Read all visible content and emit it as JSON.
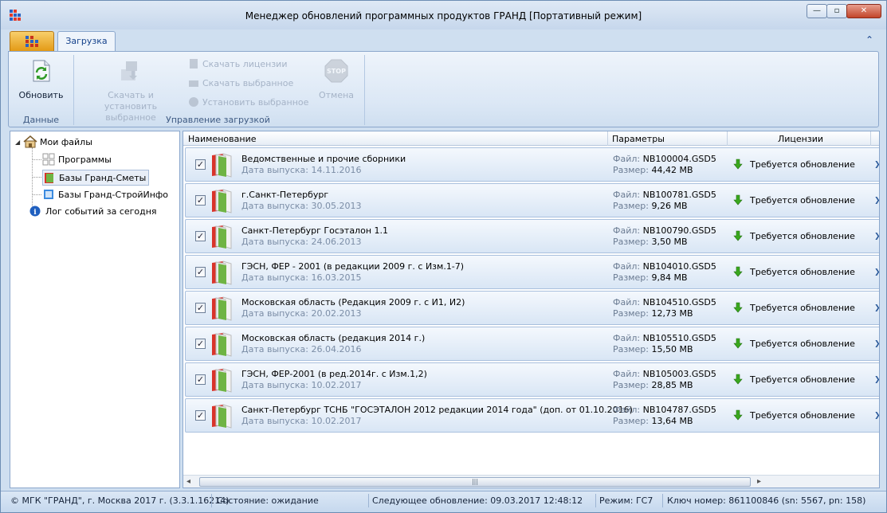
{
  "window": {
    "title": "Менеджер обновлений программных продуктов ГРАНД [Портативный режим]",
    "controls": {
      "minimize": "—",
      "maximize": "▫",
      "close": "✕"
    }
  },
  "tabs": {
    "active": "Загрузка"
  },
  "ribbon": {
    "refresh": "Обновить",
    "group_data": "Данные",
    "download_install": "Скачать и установить выбранное",
    "download_licenses": "Скачать лицензии",
    "download_selected": "Скачать выбранное",
    "install_selected": "Установить выбранное",
    "cancel": "Отмена",
    "group_download": "Управление загрузкой"
  },
  "tree": {
    "root": "Мои файлы",
    "programs": "Программы",
    "bases_smety": "Базы Гранд-Сметы",
    "bases_stroy": "Базы Гранд-СтройИнфо",
    "log": "Лог событий за сегодня"
  },
  "list": {
    "headers": {
      "name": "Наименование",
      "params": "Параметры",
      "licenses": "Лицензии"
    },
    "labels": {
      "release": "Дата выпуска:",
      "file": "Файл:",
      "size": "Размер:"
    },
    "rows": [
      {
        "name": "Ведомственные и прочие сборники",
        "date": "14.11.2016",
        "file": "NB100004.GSD5",
        "size": "44,42 MB",
        "license": "Требуется обновление"
      },
      {
        "name": "г.Санкт-Петербург",
        "date": "30.05.2013",
        "file": "NB100781.GSD5",
        "size": "9,26 MB",
        "license": "Требуется обновление"
      },
      {
        "name": "Санкт-Петербург Госэталон 1.1",
        "date": "24.06.2013",
        "file": "NB100790.GSD5",
        "size": "3,50 MB",
        "license": "Требуется обновление"
      },
      {
        "name": "ГЭСН, ФЕР - 2001 (в редакции 2009 г. с Изм.1-7)",
        "date": "16.03.2015",
        "file": "NB104010.GSD5",
        "size": "9,84 MB",
        "license": "Требуется обновление"
      },
      {
        "name": "Московская область (Редакция 2009 г. с И1, И2)",
        "date": "20.02.2013",
        "file": "NB104510.GSD5",
        "size": "12,73 MB",
        "license": "Требуется обновление"
      },
      {
        "name": "Московская область (редакция 2014 г.)",
        "date": "26.04.2016",
        "file": "NB105510.GSD5",
        "size": "15,50 MB",
        "license": "Требуется обновление"
      },
      {
        "name": "ГЭСН, ФЕР-2001 (в ред.2014г. с Изм.1,2)",
        "date": "10.02.2017",
        "file": "NB105003.GSD5",
        "size": "28,85 MB",
        "license": "Требуется обновление"
      },
      {
        "name": "Санкт-Петербург ТСНБ \"ГОСЭТАЛОН 2012 редакции 2014 года\" (доп. от 01.10.2016)",
        "date": "10.02.2017",
        "file": "NB104787.GSD5",
        "size": "13,64 MB",
        "license": "Требуется обновление"
      }
    ]
  },
  "status": {
    "copyright": "© МГК \"ГРАНД\", г. Москва 2017 г. (3.3.1.16214)",
    "state": "Состояние: ожидание",
    "next_update": "Следующее обновление: 09.03.2017 12:48:12",
    "mode": "Режим: ГС7",
    "key": "Ключ номер: 861100846 (sn: 5567, pn: 158)"
  },
  "colors": {
    "accent": "#15428b",
    "ok_arrow": "#3aa81e",
    "book_red": "#d9332a"
  }
}
